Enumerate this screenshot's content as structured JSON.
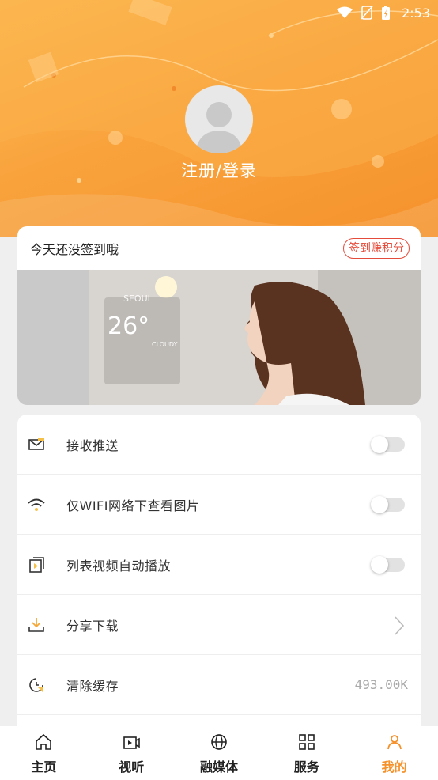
{
  "status_bar": {
    "time": "2:53"
  },
  "header": {
    "login_label": "注册/登录"
  },
  "sign_card": {
    "title": "今天还没签到哦",
    "button_label": "签到赚积分"
  },
  "banner": {
    "city": "SEOUL",
    "temperature": "26°",
    "condition": "CLOUDY"
  },
  "settings": {
    "items": [
      {
        "label": "接收推送",
        "icon": "envelope-icon",
        "control": "toggle",
        "on": false
      },
      {
        "label": "仅WIFI网络下查看图片",
        "icon": "wifi-icon",
        "control": "toggle",
        "on": false
      },
      {
        "label": "列表视频自动播放",
        "icon": "video-play-icon",
        "control": "toggle",
        "on": false
      },
      {
        "label": "分享下载",
        "icon": "download-icon",
        "control": "chevron"
      },
      {
        "label": "清除缓存",
        "icon": "clock-clear-icon",
        "control": "value",
        "value": "493.00K"
      }
    ]
  },
  "tabbar": {
    "tabs": [
      {
        "label": "主页",
        "icon": "home-icon"
      },
      {
        "label": "视听",
        "icon": "tv-icon"
      },
      {
        "label": "融媒体",
        "icon": "globe-icon"
      },
      {
        "label": "服务",
        "icon": "grid-icon"
      },
      {
        "label": "我的",
        "icon": "user-icon",
        "active": true
      }
    ]
  },
  "colors": {
    "accent": "#f5922c",
    "sign_red": "#e54b3a"
  }
}
